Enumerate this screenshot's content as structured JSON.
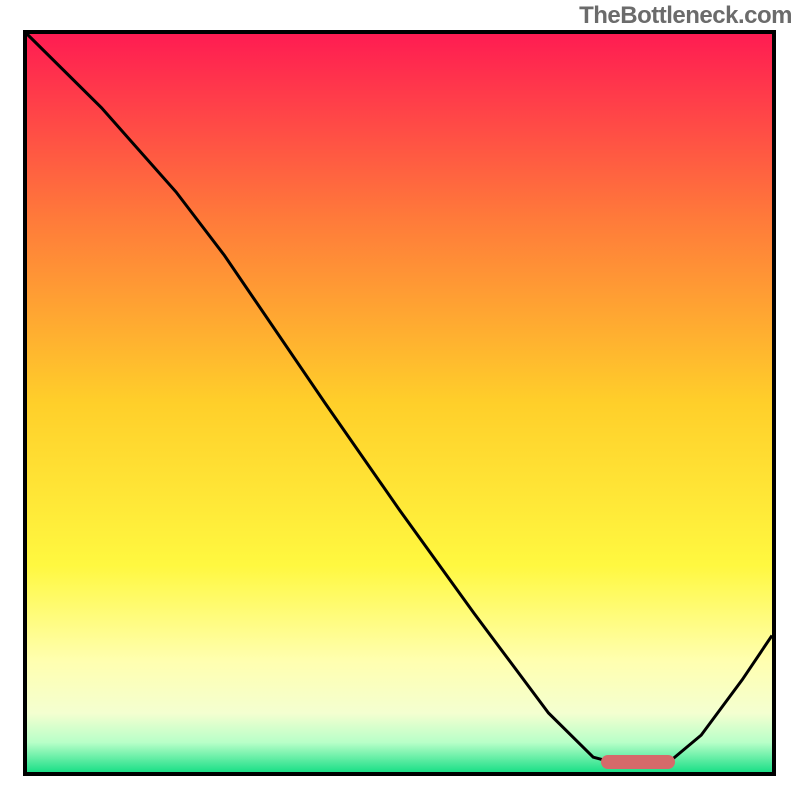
{
  "watermark": "TheBottleneck.com",
  "chart_data": {
    "type": "line",
    "title": "",
    "xlabel": "",
    "ylabel": "",
    "x_range_normalized": [
      0,
      1
    ],
    "y_range_normalized": [
      0,
      1
    ],
    "curve_points_normalized": [
      {
        "x": 0.0,
        "y": 1.0
      },
      {
        "x": 0.1,
        "y": 0.9
      },
      {
        "x": 0.2,
        "y": 0.786
      },
      {
        "x": 0.265,
        "y": 0.7
      },
      {
        "x": 0.4,
        "y": 0.5
      },
      {
        "x": 0.5,
        "y": 0.355
      },
      {
        "x": 0.6,
        "y": 0.215
      },
      {
        "x": 0.7,
        "y": 0.08
      },
      {
        "x": 0.76,
        "y": 0.02
      },
      {
        "x": 0.79,
        "y": 0.012
      },
      {
        "x": 0.86,
        "y": 0.012
      },
      {
        "x": 0.905,
        "y": 0.05
      },
      {
        "x": 0.96,
        "y": 0.125
      },
      {
        "x": 1.0,
        "y": 0.185
      }
    ],
    "optimum_marker": {
      "x_start": 0.77,
      "x_end": 0.87,
      "y": 0.013,
      "color": "#d66a6a"
    },
    "background_gradient_stops": [
      {
        "pos": 0.0,
        "color": "#ff1c52"
      },
      {
        "pos": 0.25,
        "color": "#ff7a3a"
      },
      {
        "pos": 0.5,
        "color": "#ffcf2a"
      },
      {
        "pos": 0.72,
        "color": "#fff840"
      },
      {
        "pos": 0.85,
        "color": "#ffffb0"
      },
      {
        "pos": 0.92,
        "color": "#f4ffd0"
      },
      {
        "pos": 0.96,
        "color": "#b8ffc8"
      },
      {
        "pos": 1.0,
        "color": "#1bdf87"
      }
    ],
    "note": "Normalized coordinates: x from 0 (left edge of plot) to 1 (right edge); y from 0 (bottom edge / green) to 1 (top edge / red). Curve shows bottleneck mismatch; minimum near x≈0.82 marked by red bar."
  }
}
